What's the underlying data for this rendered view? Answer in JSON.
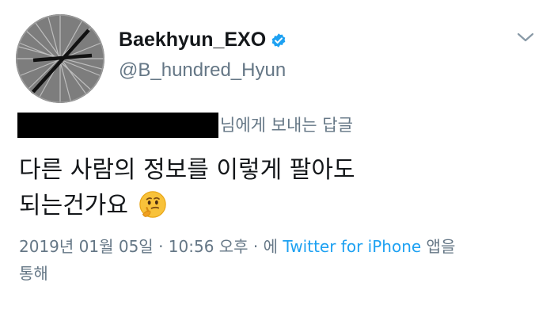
{
  "tweet": {
    "author": {
      "display_name": "Baekhyun_EXO",
      "handle": "@B_hundred_Hyun",
      "verified": true,
      "avatar_icon": "avatar-lines-icon"
    },
    "menu_icon": "chevron-down-icon",
    "reply_context": {
      "label": "님에게 보내는 답글"
    },
    "text_lines": [
      "다른 사람의 정보를 이렇게 팔아도",
      "되는건가요"
    ],
    "emoji": "thinking-face-icon",
    "meta": {
      "datetime": "2019년 01월 05일 · 10:56 오후 · 에",
      "source": "Twitter for iPhone",
      "suffix": "앱을",
      "suffix_line2": "통해"
    },
    "colors": {
      "text": "#14171a",
      "secondary": "#657786",
      "accent": "#1da1f2",
      "redaction": "#000000"
    }
  }
}
